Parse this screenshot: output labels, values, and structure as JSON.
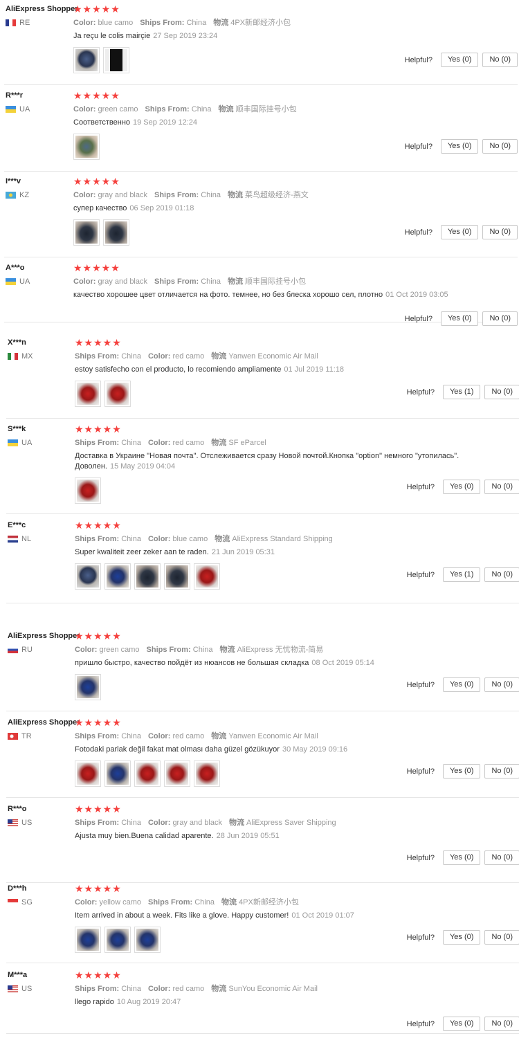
{
  "ui": {
    "helpful_label": "Helpful?",
    "color_key": "Color:",
    "ships_key": "Ships From:",
    "logistics_key": "物流",
    "stars": "★★★★★",
    "star_color": "#f5403d"
  },
  "reviews": [
    {
      "name": "AliExpress Shopper",
      "country": "RE",
      "flag": "fr",
      "order": "c",
      "color": "blue camo",
      "ships": "China",
      "logistics": "4PX新邮经济小包",
      "text": "Ja reçu le colis mairçie",
      "date": "27 Sep 2019 23:24",
      "photos": [
        "ph-dark",
        "ph-phone"
      ],
      "yes": "Yes (0)",
      "no": "No (0)"
    },
    {
      "name": "R***r",
      "country": "UA",
      "flag": "ua",
      "order": "c",
      "color": "green camo",
      "ships": "China",
      "logistics": "顺丰国际挂号小包",
      "text": "Соответственно",
      "date": "19 Sep 2019 12:24",
      "photos": [
        "ph-green"
      ],
      "yes": "Yes (0)",
      "no": "No (0)"
    },
    {
      "name": "I***v",
      "country": "KZ",
      "flag": "kz",
      "order": "c",
      "color": "gray and black",
      "ships": "China",
      "logistics": "菜鸟超级经济-燕文",
      "text": "супер качество",
      "date": "06 Sep 2019 01:18",
      "photos": [
        "ph-black",
        "ph-black"
      ],
      "yes": "Yes (0)",
      "no": "No (0)"
    },
    {
      "name": "A***o",
      "country": "UA",
      "flag": "ua",
      "order": "c",
      "color": "gray and black",
      "ships": "China",
      "logistics": "顺丰国际挂号小包",
      "text": "качество хорошее цвет отличается на фото. темнее, но без блеска хорошо сел, плотно",
      "date": "01 Oct 2019 03:05",
      "photos": [],
      "yes": "Yes (0)",
      "no": "No (0)"
    },
    {
      "name": "X***n",
      "country": "MX",
      "flag": "mx",
      "order": "s",
      "color": "red camo",
      "ships": "China",
      "logistics": "Yanwen Economic Air Mail",
      "text": "estoy satisfecho con el producto, lo recomiendo ampliamente",
      "date": "01 Jul 2019 11:18",
      "photos": [
        "ph-red",
        "ph-red"
      ],
      "yes": "Yes (1)",
      "no": "No (0)"
    },
    {
      "name": "S***k",
      "country": "UA",
      "flag": "ua",
      "order": "s",
      "color": "red camo",
      "ships": "China",
      "logistics": "SF eParcel",
      "text": "Доставка в Украине \"Новая почта\". Отслеживается сразу Новой почтой.Кнопка \"option\" немного \"утопилась\". Доволен.",
      "date": "15 May 2019 04:04",
      "photos": [
        "ph-red"
      ],
      "yes": "Yes (0)",
      "no": "No (0)"
    },
    {
      "name": "E***c",
      "country": "NL",
      "flag": "nl",
      "order": "s",
      "color": "blue camo",
      "ships": "China",
      "logistics": "AliExpress Standard Shipping",
      "text": "Super kwaliteit zeer zeker aan te raden.",
      "date": "21 Jun 2019 05:31",
      "photos": [
        "ph-dark",
        "ph-blue",
        "ph-black",
        "ph-black",
        "ph-red"
      ],
      "yes": "Yes (1)",
      "no": "No (0)"
    },
    {
      "name": "AliExpress Shopper",
      "country": "RU",
      "flag": "ru",
      "order": "c",
      "color": "green camo",
      "ships": "China",
      "logistics": "AliExpress 无忧物流-简易",
      "text": "пришло быстро, качество пойдёт из нюансов не большая складка",
      "date": "08 Oct 2019 05:14",
      "photos": [
        "ph-blue"
      ],
      "yes": "Yes (0)",
      "no": "No (0)"
    },
    {
      "name": "AliExpress Shopper",
      "country": "TR",
      "flag": "tr",
      "order": "s",
      "color": "red camo",
      "ships": "China",
      "logistics": "Yanwen Economic Air Mail",
      "text": "Fotodaki parlak değil fakat mat olması daha güzel gözükuyor",
      "date": "30 May 2019 09:16",
      "photos": [
        "ph-red",
        "ph-blue",
        "ph-red",
        "ph-red",
        "ph-red"
      ],
      "yes": "Yes (0)",
      "no": "No (0)"
    },
    {
      "name": "R***o",
      "country": "US",
      "flag": "us",
      "order": "s",
      "color": "gray and black",
      "ships": "China",
      "logistics": "AliExpress Saver Shipping",
      "text": "Ajusta muy bien.Buena calidad aparente.",
      "date": "28 Jun 2019 05:51",
      "photos": [],
      "yes": "Yes (0)",
      "no": "No (0)"
    },
    {
      "name": "D***h",
      "country": "SG",
      "flag": "sg",
      "order": "c",
      "color": "yellow camo",
      "ships": "China",
      "logistics": "4PX新邮经济小包",
      "text": "Item arrived in about a week. Fits like a glove. Happy customer!",
      "date": "01 Oct 2019 01:07",
      "photos": [
        "ph-blue",
        "ph-blue",
        "ph-blue"
      ],
      "yes": "Yes (0)",
      "no": "No (0)"
    },
    {
      "name": "M***a",
      "country": "US",
      "flag": "us",
      "order": "s",
      "color": "red camo",
      "ships": "China",
      "logistics": "SunYou Economic Air Mail",
      "text": "llego rapido",
      "date": "10 Aug 2019 20:47",
      "photos": [],
      "yes": "Yes (0)",
      "no": "No (0)"
    }
  ]
}
